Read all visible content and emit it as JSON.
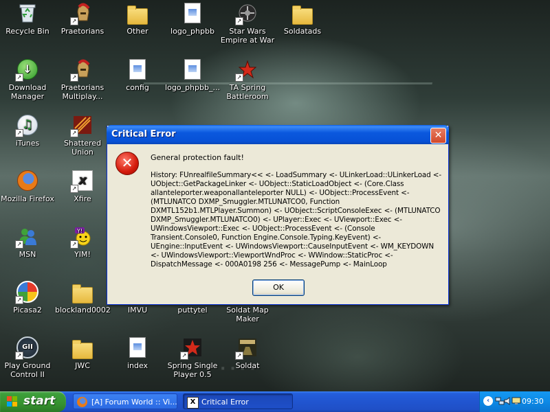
{
  "desktop": {
    "icons": [
      {
        "label": "Recycle Bin",
        "icon": "recycle-bin-icon",
        "shortcut": false
      },
      {
        "label": "Praetorians",
        "icon": "praetorians-icon",
        "shortcut": true
      },
      {
        "label": "Other",
        "icon": "folder-icon",
        "shortcut": false
      },
      {
        "label": "logo_phpbb",
        "icon": "image-file-icon",
        "shortcut": false
      },
      {
        "label": "Star Wars Empire at War",
        "icon": "star-wars-icon",
        "shortcut": true
      },
      {
        "label": "Soldatads",
        "icon": "folder-icon",
        "shortcut": false
      },
      {
        "label": "Download Manager",
        "icon": "download-manager-icon",
        "shortcut": true
      },
      {
        "label": "Praetorians Multiplay...",
        "icon": "praetorians-icon",
        "shortcut": true
      },
      {
        "label": "config",
        "icon": "text-file-icon",
        "shortcut": false
      },
      {
        "label": "logo_phpbb_...",
        "icon": "image-file-icon",
        "shortcut": false
      },
      {
        "label": "TA Spring Battleroom",
        "icon": "ta-spring-icon",
        "shortcut": true
      },
      {
        "label": "iTunes",
        "icon": "itunes-icon",
        "shortcut": true
      },
      {
        "label": "Shattered Union",
        "icon": "shattered-union-icon",
        "shortcut": true
      },
      {
        "label": "Mozilla Firefox",
        "icon": "firefox-icon",
        "shortcut": false
      },
      {
        "label": "Xfire",
        "icon": "xfire-icon",
        "shortcut": true
      },
      {
        "label": "MSN",
        "icon": "msn-icon",
        "shortcut": true
      },
      {
        "label": "YIM!",
        "icon": "yahoo-messenger-icon",
        "shortcut": true
      },
      {
        "label": "Picasa2",
        "icon": "picasa-icon",
        "shortcut": true
      },
      {
        "label": "blockland0002",
        "icon": "folder-icon",
        "shortcut": false
      },
      {
        "label": "IMVU",
        "icon": "imvu-icon",
        "shortcut": true
      },
      {
        "label": "puttytel",
        "icon": "puttytel-icon",
        "shortcut": true
      },
      {
        "label": "Soldat Map Maker",
        "icon": "soldat-map-maker-icon",
        "shortcut": true
      },
      {
        "label": "Play Ground Control II",
        "icon": "ground-control-icon",
        "shortcut": true
      },
      {
        "label": "JWC",
        "icon": "folder-icon",
        "shortcut": false
      },
      {
        "label": "index",
        "icon": "text-file-icon",
        "shortcut": false
      },
      {
        "label": "Spring Single Player 0.5",
        "icon": "spring-icon",
        "shortcut": true
      },
      {
        "label": "Soldat",
        "icon": "soldat-icon",
        "shortcut": true
      }
    ]
  },
  "dialog": {
    "title": "Critical Error",
    "close_icon": "close-icon",
    "icon": "error-icon",
    "heading": "General protection fault!",
    "history": "History: FUnrealfileSummary<< <- LoadSummary <- ULinkerLoad::ULinkerLoad <- UObject::GetPackageLinker <- UObject::StaticLoadObject <- (Core.Class allanteleporter.weaponallanteleporter NULL) <- UObject::ProcessEvent <- (MTLUNATCO DXMP_Smuggler.MTLUNATCO0, Function DXMTL152b1.MTLPlayer.Summon) <- UObject::ScriptConsoleExec <- (MTLUNATCO DXMP_Smuggler.MTLUNATCO0) <- UPlayer::Exec <- UViewport::Exec <- UWindowsViewport::Exec <- UObject::ProcessEvent <- (Console Transient.Console0, Function Engine.Console.Typing.KeyEvent) <- UEngine::InputEvent <- UWindowsViewport::CauseInputEvent <- WM_KEYDOWN <- UWindowsViewport::ViewportWndProc <- WWindow::StaticProc <- DispatchMessage <- 000A0198 256 <- MessagePump <- MainLoop",
    "ok_label": "OK"
  },
  "taskbar": {
    "start_label": "start",
    "tasks": [
      {
        "label": "[A] Forum World :: Vi...",
        "icon": "firefox-icon"
      },
      {
        "label": "Critical Error",
        "icon": "deus-ex-icon"
      }
    ],
    "tray_icons": [
      "show-hidden-icons-icon",
      "network-icon",
      "volume-icon",
      "monitor-icon"
    ],
    "clock": "09:30"
  },
  "colors": {
    "taskbar_blue": "#245edb",
    "start_green": "#3c9e3a",
    "title_blue": "#0b58de",
    "dialog_bg": "#ece9d8",
    "close_red": "#d2482a"
  }
}
